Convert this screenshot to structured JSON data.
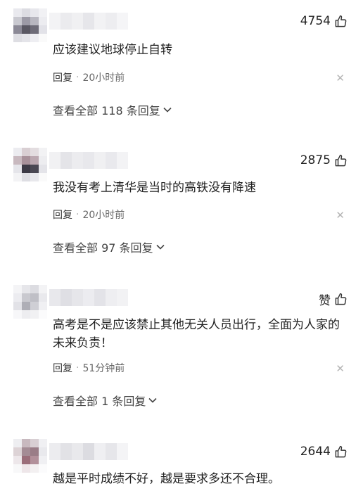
{
  "comments": [
    {
      "likes": "4754",
      "text": "应该建议地球停止自转",
      "reply_label": "回复",
      "separator": "·",
      "time": "20小时前",
      "view_replies": "查看全部 118 条回复"
    },
    {
      "likes": "2875",
      "text": "我没有考上清华是当时的高铁没有降速",
      "reply_label": "回复",
      "separator": "·",
      "time": "20小时前",
      "view_replies": "查看全部 97 条回复"
    },
    {
      "likes": "赞",
      "text": "高考是不是应该禁止其他无关人员出行，全面为人家的未来负责！",
      "reply_label": "回复",
      "separator": "·",
      "time": "51分钟前",
      "view_replies": "查看全部 1 条回复"
    },
    {
      "likes": "2644",
      "text": "越是平时成绩不好，越是要求多还不合理。"
    }
  ],
  "icons": {
    "like": "thumbs-up-icon",
    "close": "close-icon",
    "expand": "chevron-down-icon"
  },
  "colors": {
    "text": "#222222",
    "secondary": "#666666",
    "close": "#b5b5b5"
  }
}
